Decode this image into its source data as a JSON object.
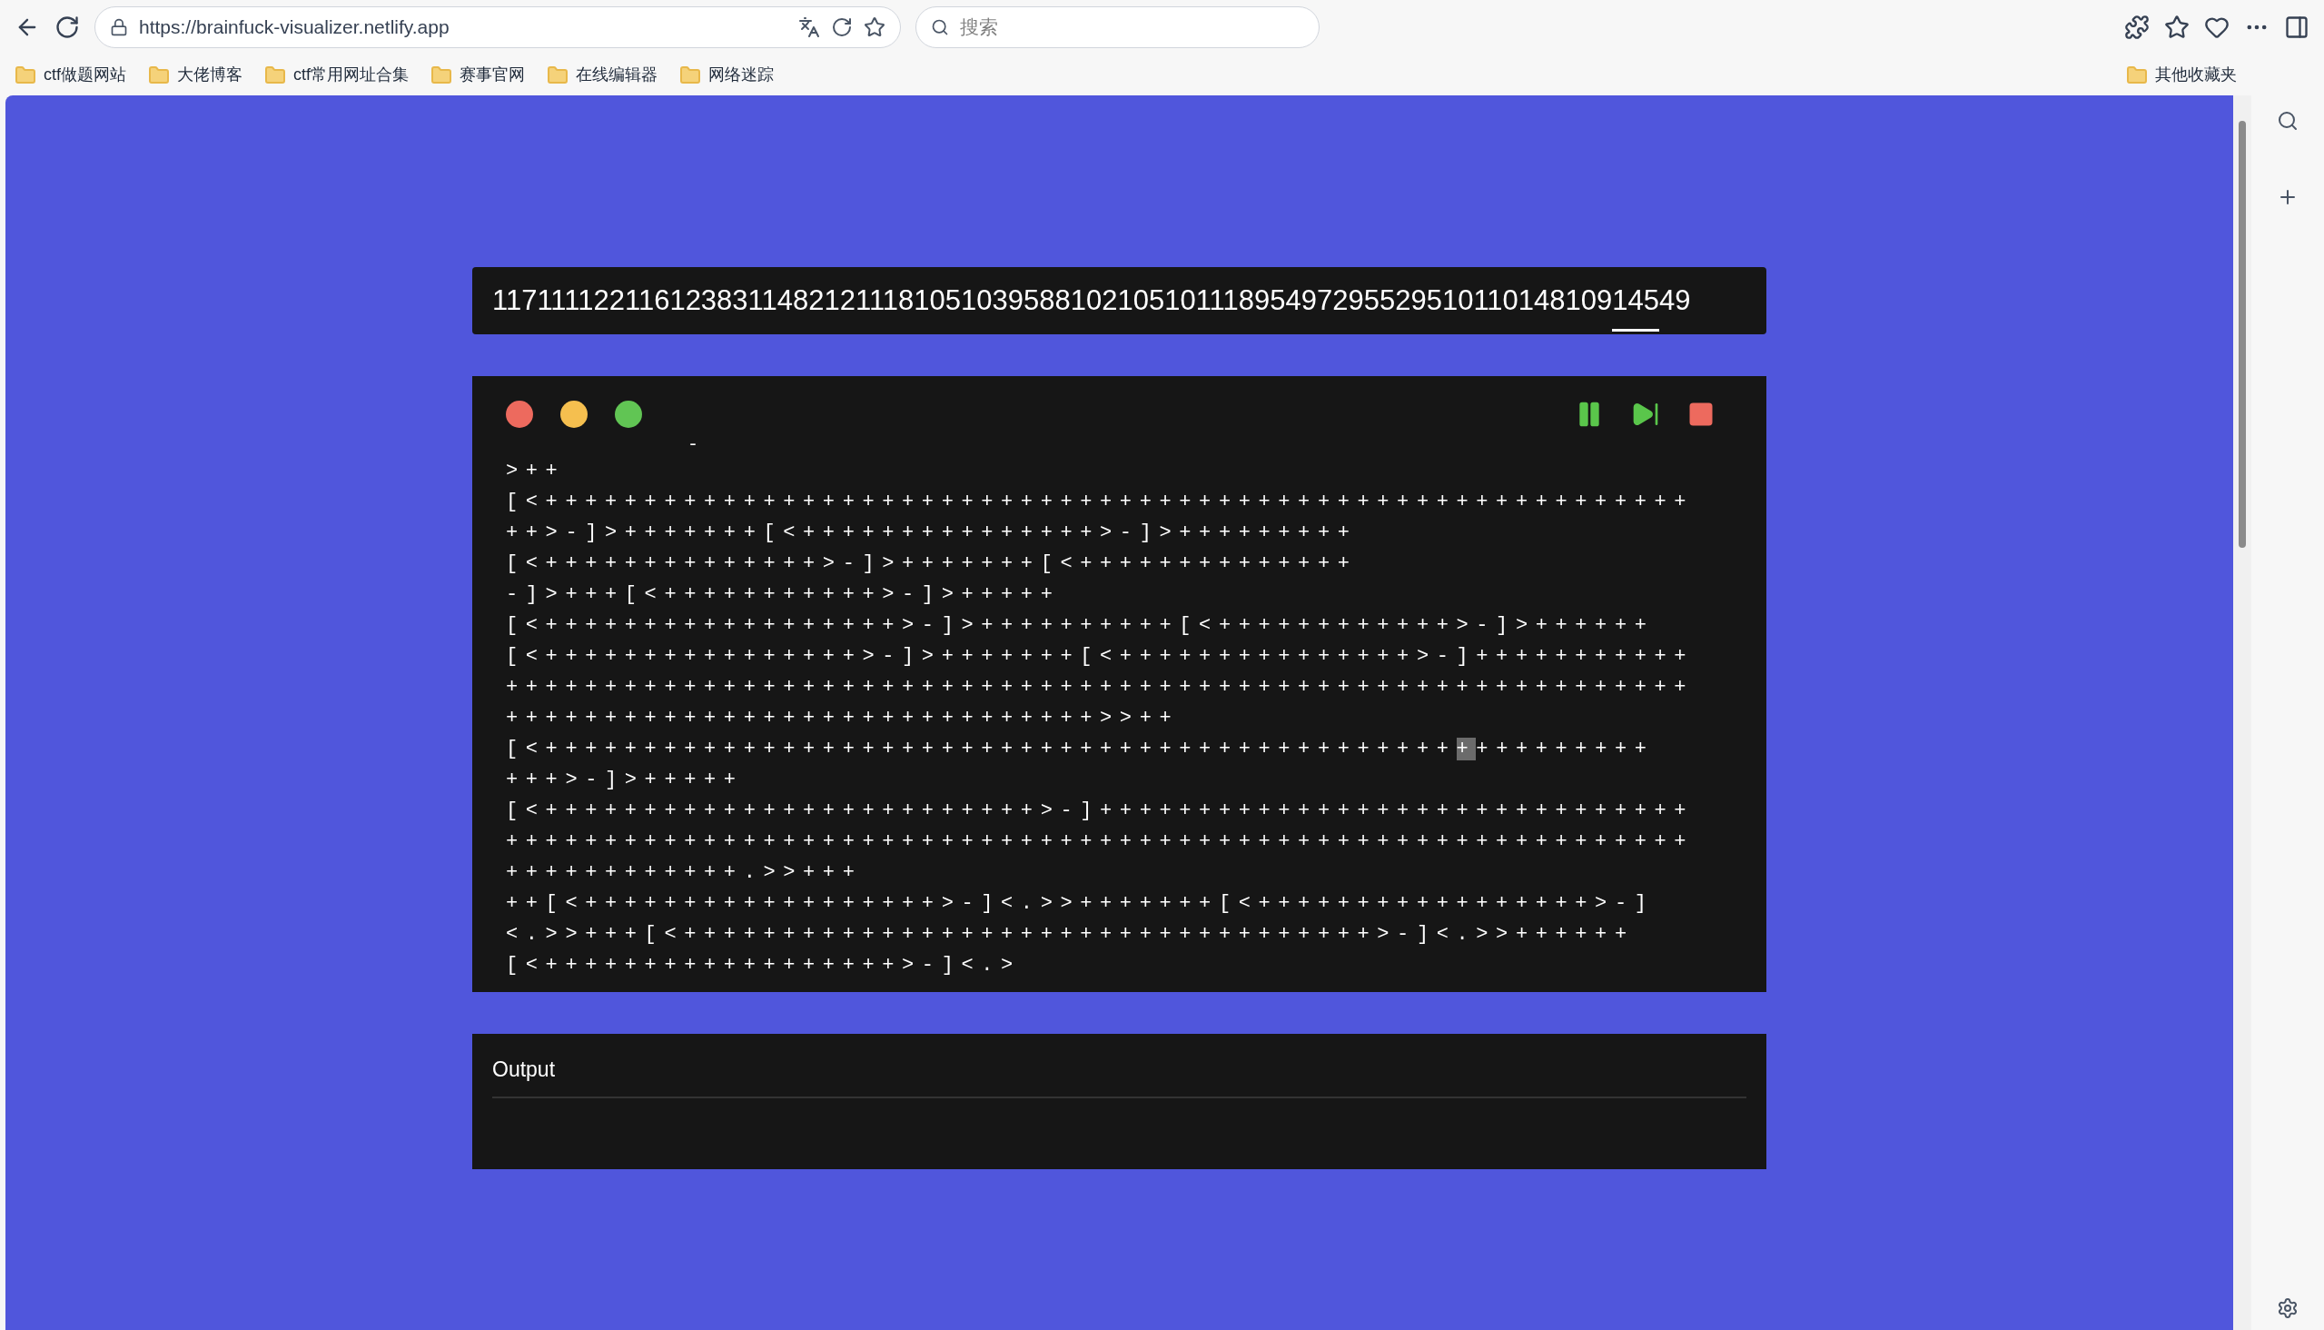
{
  "browser": {
    "url": "https://brainfuck-visualizer.netlify.app",
    "search_placeholder": "搜索",
    "bookmarks": [
      "ctf做题网站",
      "大佬博客",
      "ctf常用网址合集",
      "赛事官网",
      "在线编辑器",
      "网络迷踪"
    ],
    "other_bookmarks": "其他收藏夹"
  },
  "input_bar": {
    "segments": [
      {
        "text": "1171111221161238311482121118105103958810210510111895497295529510110148109",
        "selected": false
      },
      {
        "text": "145",
        "selected": true
      },
      {
        "text": "49",
        "selected": false
      }
    ]
  },
  "editor": {
    "pointer_mark": "-",
    "lines": [
      [
        {
          "text": ">++",
          "selected": false
        }
      ],
      [
        {
          "text": "[<++++++++++++++++++++++++++++++++++++++++++++++++++++++++++",
          "selected": false
        }
      ],
      [
        {
          "text": "++>-]>+++++++[<+++++++++++++++>-]>+++++++++",
          "selected": false
        }
      ],
      [
        {
          "text": "[<++++++++++++++>-]>+++++++[<++++++++++++++",
          "selected": false
        }
      ],
      [
        {
          "text": "-]>+++[<+++++++++++>-]>+++++",
          "selected": false
        }
      ],
      [
        {
          "text": "[<++++++++++++++++++>-]>++++++++++[<++++++++++++>-]>++++++",
          "selected": false
        }
      ],
      [
        {
          "text": "[<++++++++++++++++>-]>+++++++[<+++++++++++++++>-]+++++++++++",
          "selected": false
        }
      ],
      [
        {
          "text": "++++++++++++++++++++++++++++++++++++++++++++++++++++++++++++",
          "selected": false
        }
      ],
      [
        {
          "text": "++++++++++++++++++++++++++++++>>++",
          "selected": false
        }
      ],
      [
        {
          "text": "[<++++++++++++++++++++++++++++++++++++++++++++++",
          "selected": false
        },
        {
          "text": "+",
          "selected": true
        },
        {
          "text": "+++++++++",
          "selected": false
        }
      ],
      [
        {
          "text": "+++>-]>+++++",
          "selected": false
        }
      ],
      [
        {
          "text": "[<+++++++++++++++++++++++++>-]++++++++++++++++++++++++++++++",
          "selected": false
        }
      ],
      [
        {
          "text": "++++++++++++++++++++++++++++++++++++++++++++++++++++++++++++",
          "selected": false
        }
      ],
      [
        {
          "text": "++++++++++++.>>+++",
          "selected": false
        }
      ],
      [
        {
          "text": "++[<++++++++++++++++++>-]<.>>+++++++[<+++++++++++++++++>-]",
          "selected": false
        }
      ],
      [
        {
          "text": "<.>>+++[<+++++++++++++++++++++++++++++++++++>-]<.>>++++++",
          "selected": false
        }
      ],
      [
        {
          "text": "[<++++++++++++++++++>-]<.>",
          "selected": false
        }
      ]
    ]
  },
  "output": {
    "title": "Output"
  }
}
